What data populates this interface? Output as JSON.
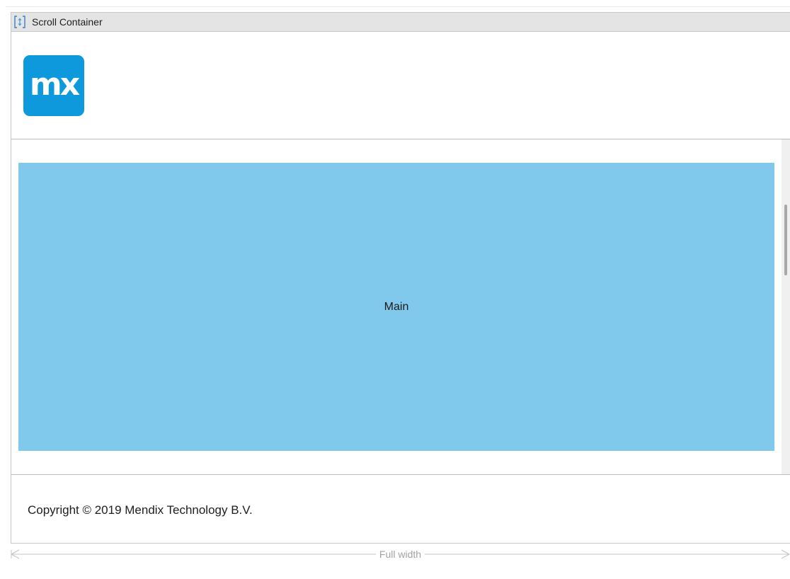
{
  "container": {
    "title": "Scroll Container",
    "icon": "scroll-container-icon"
  },
  "header": {
    "logo_text": "mx",
    "logo_color": "#0d99dc"
  },
  "main": {
    "label": "Main",
    "color": "#81c9ec"
  },
  "footer": {
    "text": "Copyright © 2019 Mendix Technology B.V."
  },
  "width_indicator": {
    "label": "Full width"
  }
}
